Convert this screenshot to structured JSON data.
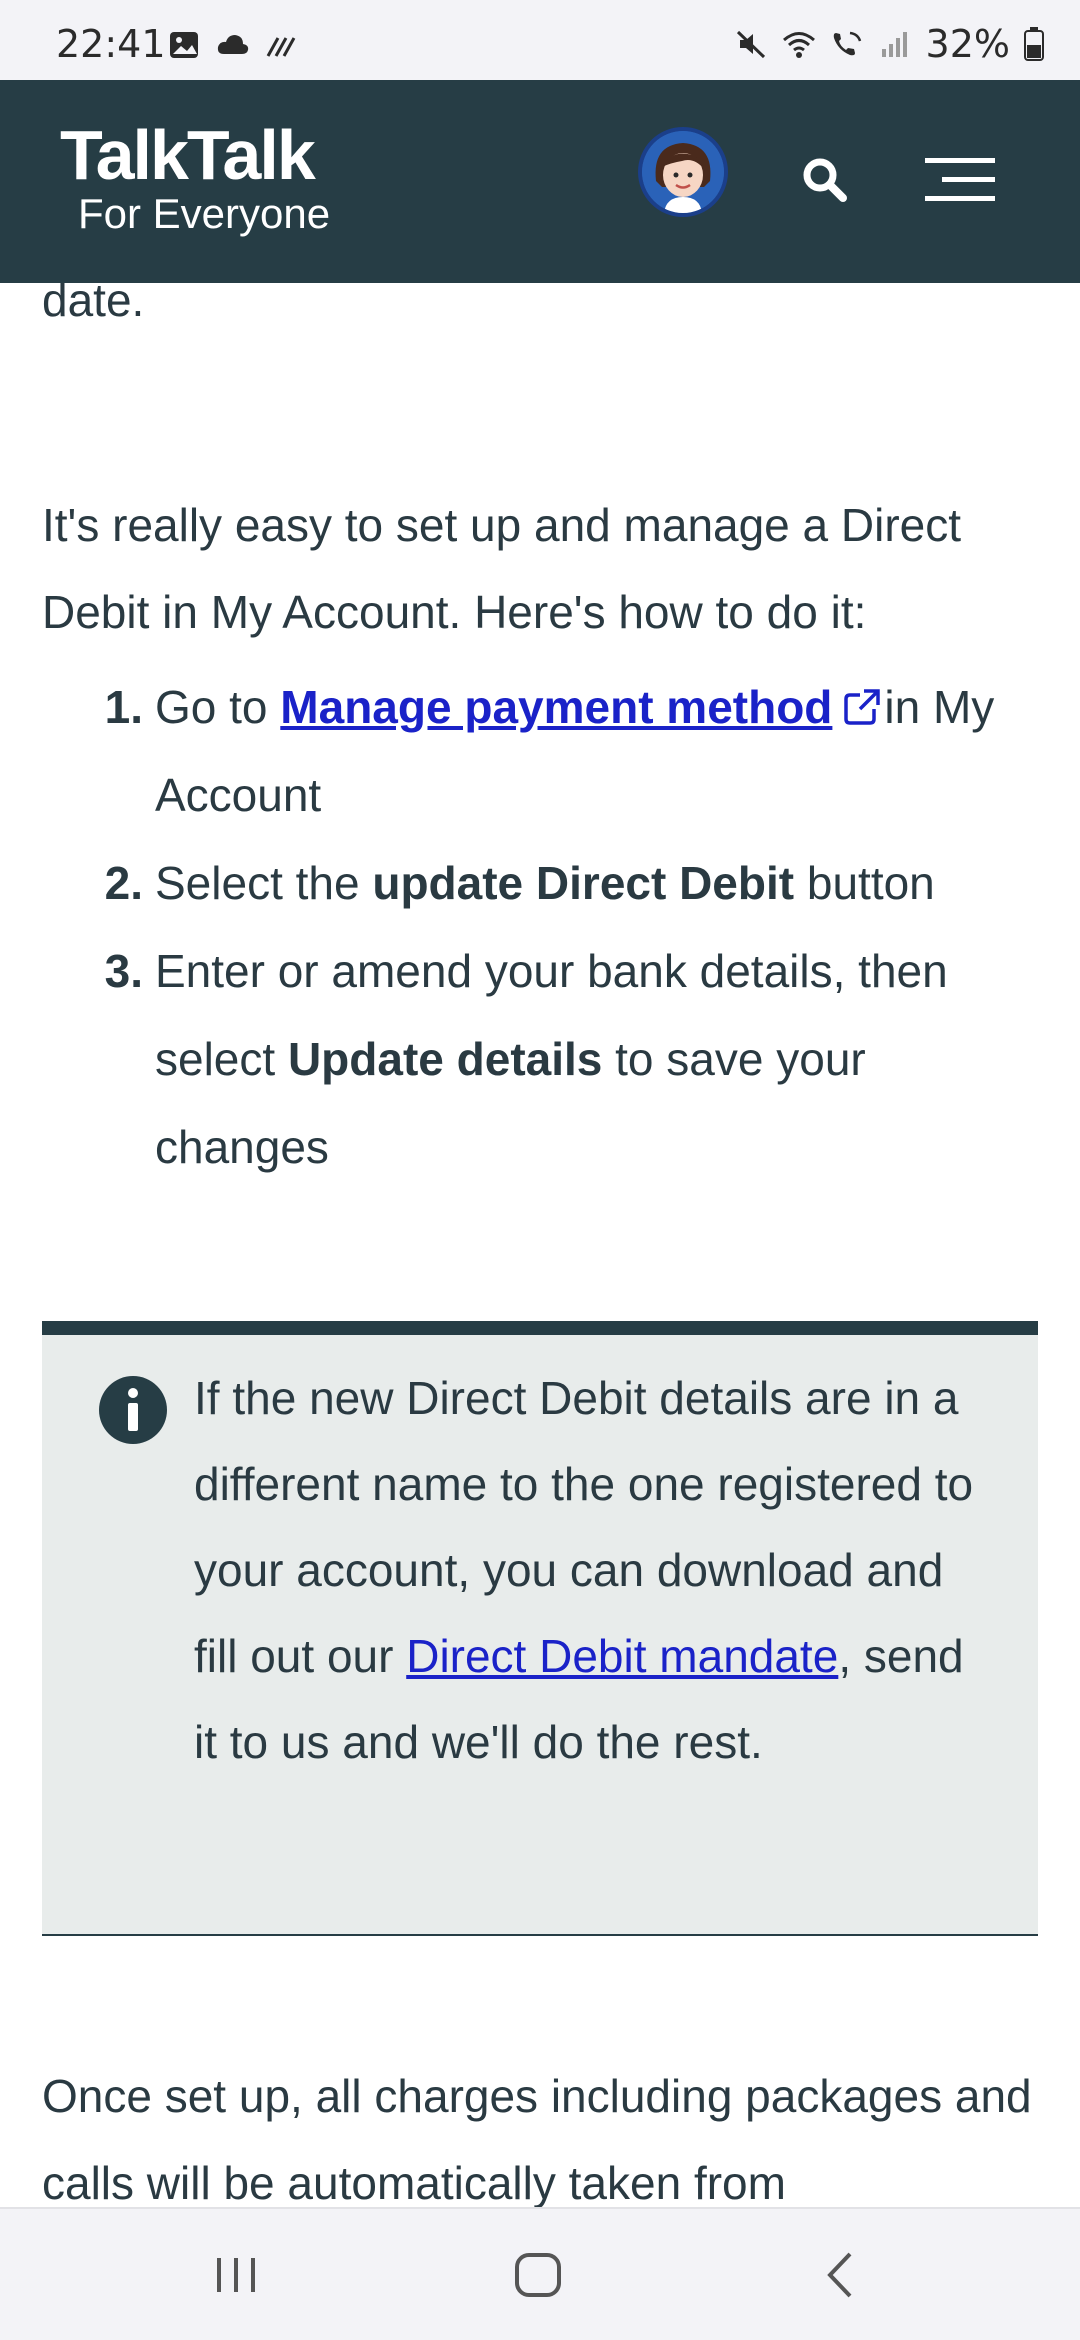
{
  "status_bar": {
    "time": "22:41",
    "battery": "32%"
  },
  "header": {
    "logo_main": "TalkTalk",
    "logo_sub": "For Everyone"
  },
  "content": {
    "partial_top": "date.",
    "intro": "It's really easy to set up and manage a Direct Debit in My Account. Here's how to do it:",
    "steps": [
      {
        "num": "1.",
        "pre": "Go to ",
        "link": "Manage payment method",
        "post": "in My Account"
      },
      {
        "num": "2.",
        "pre": "Select the ",
        "bold": "update Direct Debit",
        "post": " button"
      },
      {
        "num": "3.",
        "pre": "Enter or amend your bank details, then select ",
        "bold": "Update details",
        "post": " to save your changes"
      }
    ],
    "info": {
      "pre": "If the new Direct Debit details are in a different name to the one registered to your account, you can download and fill out our ",
      "link": "Direct Debit mandate",
      "post": ", send it to us and we'll do the rest."
    },
    "bottom": "Once set up, all charges including packages and calls will be automatically taken from"
  },
  "colors": {
    "header_bg": "#263d45",
    "text": "#2a3a42",
    "link": "#1a22c8",
    "info_bg": "#e8eceb"
  }
}
